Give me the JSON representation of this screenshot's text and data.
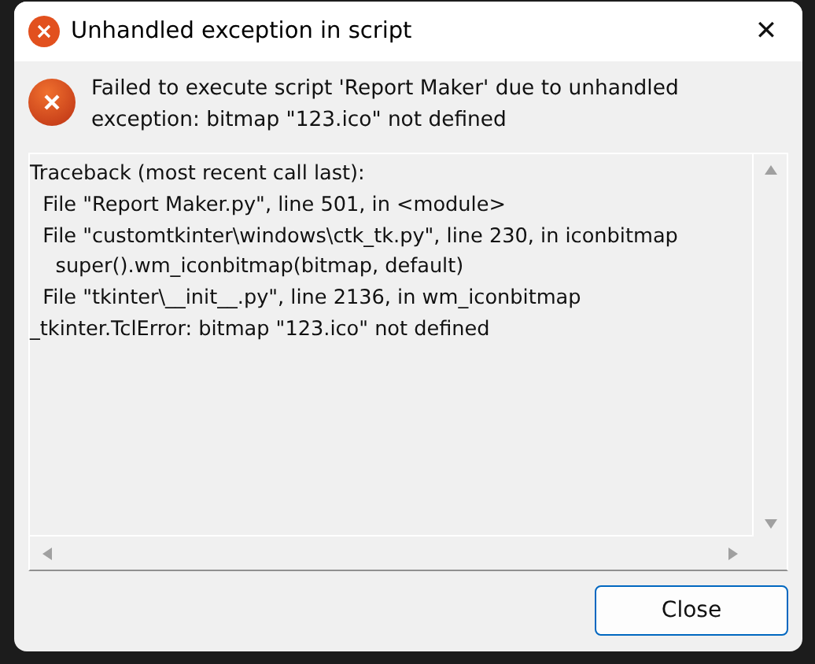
{
  "window": {
    "title": "Unhandled exception in script",
    "close_glyph": "✕"
  },
  "message": "Failed to execute script 'Report Maker' due to unhandled exception: bitmap \"123.ico\" not defined",
  "traceback": [
    "Traceback (most recent call last):",
    "  File \"Report Maker.py\", line 501, in <module>",
    "  File \"customtkinter\\windows\\ctk_tk.py\", line 230, in iconbitmap",
    "    super().wm_iconbitmap(bitmap, default)",
    "  File \"tkinter\\__init__.py\", line 2136, in wm_iconbitmap",
    "_tkinter.TclError: bitmap \"123.ico\" not defined"
  ],
  "buttons": [
    "Close"
  ]
}
